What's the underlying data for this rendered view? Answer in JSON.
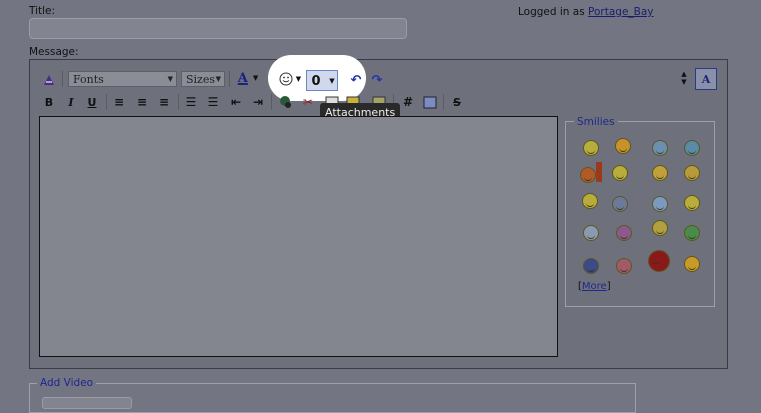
{
  "form": {
    "title_label": "Title:",
    "title_value": "",
    "message_label": "Message:",
    "logged_in_prefix": "Logged in as",
    "username": "Portage_Bay"
  },
  "toolbar": {
    "font_select": "Fonts",
    "size_select": "Sizes",
    "text_color_label": "A",
    "bold": "B",
    "italic": "I",
    "underline": "U",
    "hash": "#",
    "strike": "S",
    "attachments_tooltip": "Attachments"
  },
  "smilies": {
    "legend": "Smilies",
    "more_label": "More",
    "count": 20
  },
  "video": {
    "legend": "Add Video"
  }
}
